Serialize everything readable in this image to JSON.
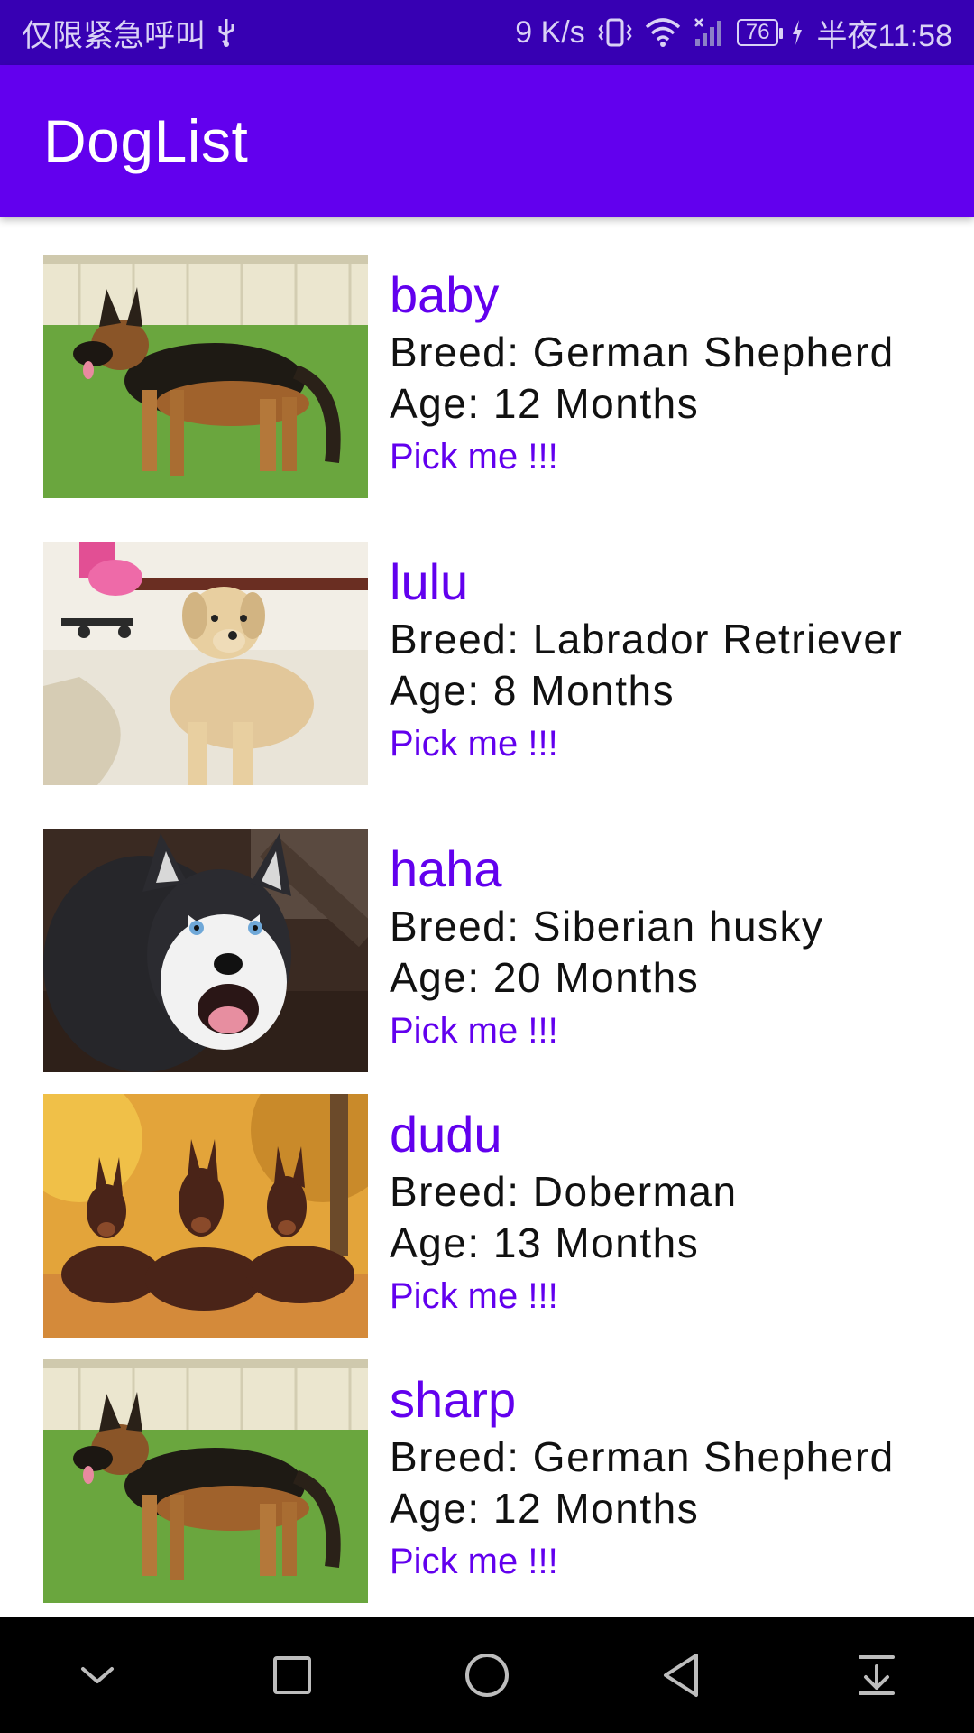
{
  "status_bar": {
    "carrier_text": "仅限紧急呼叫",
    "speed": "9 K/s",
    "battery": "76",
    "time": "半夜11:58",
    "icons": [
      "usb-icon",
      "vibrate-icon",
      "wifi-icon",
      "signal-icon",
      "battery-icon",
      "charging-icon"
    ]
  },
  "app_bar": {
    "title": "DogList"
  },
  "colors": {
    "primary": "#6200ee",
    "primary_dark": "#3700b3",
    "nav": "#000000"
  },
  "dogs": [
    {
      "name": "baby",
      "breed": "Breed: German Shepherd",
      "age": "Age: 12 Months",
      "action": "Pick me !!!",
      "photo": "german-shepherd-photo"
    },
    {
      "name": "lulu",
      "breed": "Breed: Labrador Retriever",
      "age": "Age: 8 Months",
      "action": "Pick me !!!",
      "photo": "labrador-photo"
    },
    {
      "name": "haha",
      "breed": "Breed: Siberian husky",
      "age": "Age: 20 Months",
      "action": "Pick me !!!",
      "photo": "husky-photo"
    },
    {
      "name": "dudu",
      "breed": "Breed: Doberman",
      "age": "Age: 13 Months",
      "action": "Pick me !!!",
      "photo": "doberman-photo"
    },
    {
      "name": "sharp",
      "breed": "Breed: German Shepherd",
      "age": "Age: 12 Months",
      "action": "Pick me !!!",
      "photo": "german-shepherd-photo"
    }
  ],
  "nav_bar": {
    "buttons": [
      "collapse-icon",
      "recents-icon",
      "home-icon",
      "back-icon",
      "notifications-icon"
    ]
  }
}
